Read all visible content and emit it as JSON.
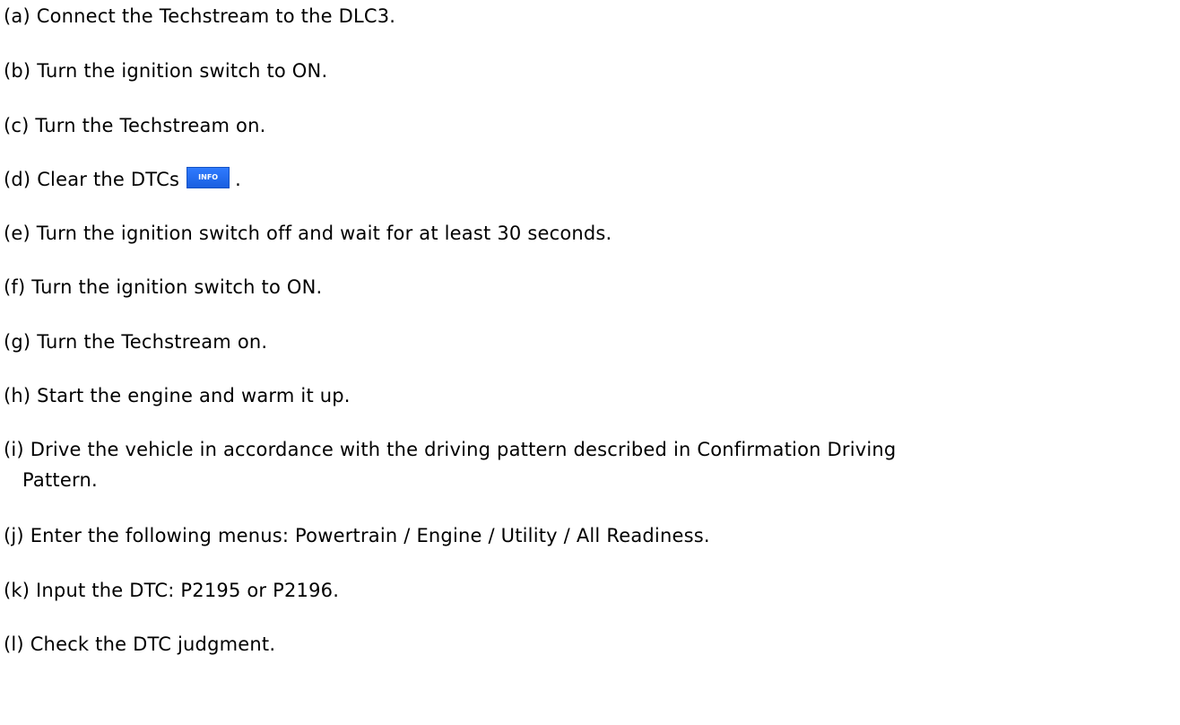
{
  "steps": [
    {
      "text": "(a) Connect the Techstream to the DLC3."
    },
    {
      "text": "(b) Turn the ignition switch to ON."
    },
    {
      "text": "(c) Turn the Techstream on."
    },
    {
      "text": "(d) Clear the DTCs",
      "after": ".",
      "button_label": "INFO"
    },
    {
      "text": "(e) Turn the ignition switch off and wait for at least 30 seconds."
    },
    {
      "text": "(f) Turn the ignition switch to ON."
    },
    {
      "text": "(g) Turn the Techstream on."
    },
    {
      "text": "(h) Start the engine and warm it up."
    },
    {
      "text": "(i) Drive the vehicle in accordance with the driving pattern described in Confirmation Driving",
      "cont": "Pattern."
    },
    {
      "text": "(j) Enter the following menus: Powertrain / Engine / Utility / All Readiness."
    },
    {
      "text": "(k) Input the DTC: P2195 or P2196."
    },
    {
      "text": "(l) Check the DTC judgment."
    }
  ],
  "colors": {
    "info_button": "#2170f5",
    "text": "#000000"
  },
  "icons": {
    "info_button": "info-button-icon"
  }
}
